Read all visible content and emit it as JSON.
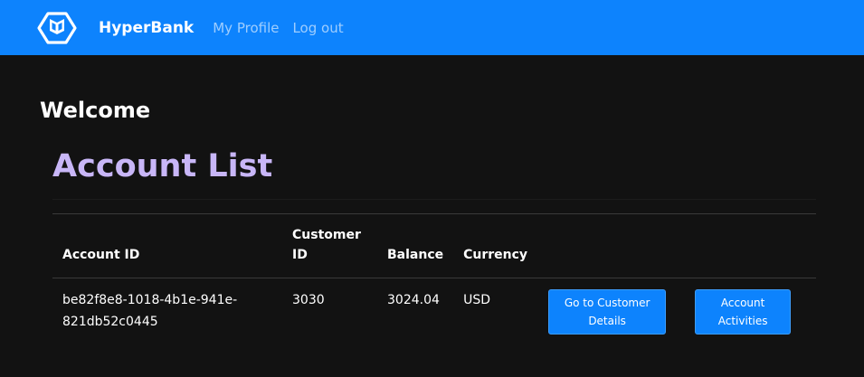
{
  "navbar": {
    "logo_icon": "hexagon-cube-logo-icon",
    "brand": "HyperBank",
    "links": [
      "My Profile",
      "Log out"
    ],
    "bg_color": "#0d83fd"
  },
  "main": {
    "welcome": "Welcome",
    "title": "Account List",
    "title_color": "#c8b6f7"
  },
  "table": {
    "headers": {
      "account_id": "Account ID",
      "customer_id": "Customer ID",
      "balance": "Balance",
      "currency": "Currency"
    },
    "rows": [
      {
        "account_id": "be82f8e8-1018-4b1e-941e-821db52c0445",
        "customer_id": "3030",
        "balance": "3024.04",
        "currency": "USD",
        "customer_button": "Go to Customer Details",
        "activities_button": "Account Activities"
      }
    ]
  }
}
